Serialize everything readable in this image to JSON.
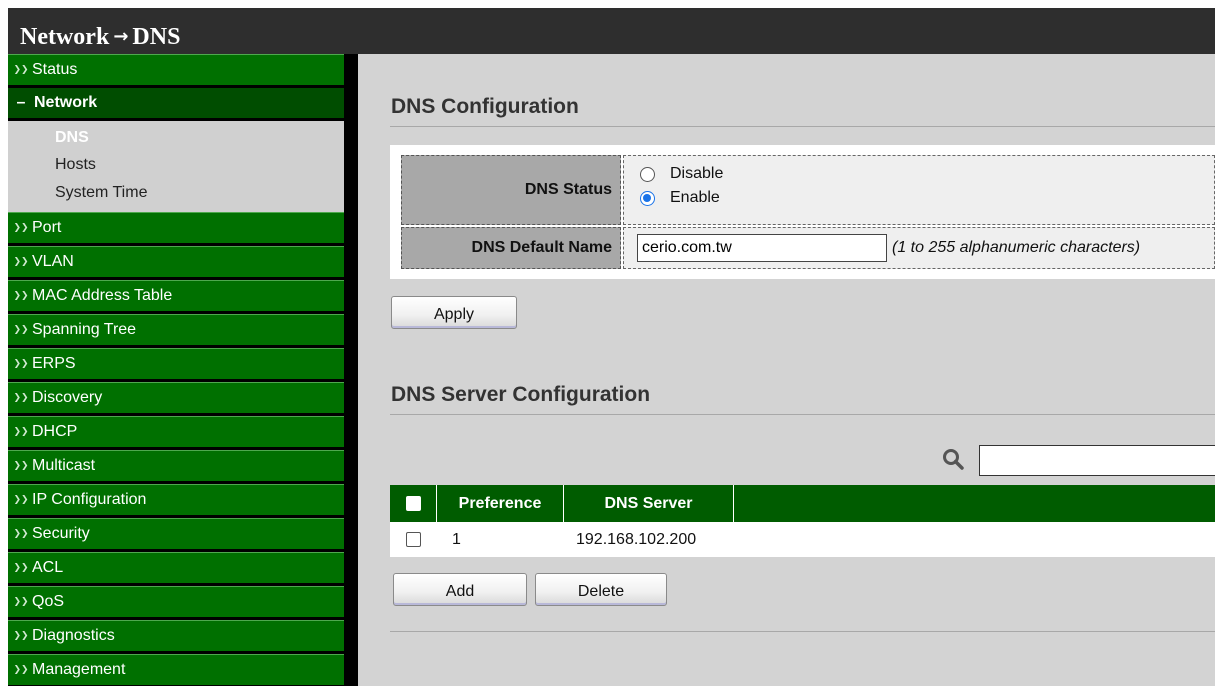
{
  "header": {
    "breadcrumb_parent": "Network",
    "breadcrumb_sep": "→",
    "breadcrumb_current": "DNS"
  },
  "sidebar": {
    "items": [
      {
        "label": "Status",
        "icon": "double-chevron-down-icon"
      },
      {
        "label": "Network",
        "icon": "minus-icon",
        "expanded": true
      },
      {
        "label": "Port",
        "icon": "double-chevron-down-icon"
      },
      {
        "label": "VLAN",
        "icon": "double-chevron-down-icon"
      },
      {
        "label": "MAC Address Table",
        "icon": "double-chevron-down-icon"
      },
      {
        "label": "Spanning Tree",
        "icon": "double-chevron-down-icon"
      },
      {
        "label": "ERPS",
        "icon": "double-chevron-down-icon"
      },
      {
        "label": "Discovery",
        "icon": "double-chevron-down-icon"
      },
      {
        "label": "DHCP",
        "icon": "double-chevron-down-icon"
      },
      {
        "label": "Multicast",
        "icon": "double-chevron-down-icon"
      },
      {
        "label": "IP Configuration",
        "icon": "double-chevron-down-icon"
      },
      {
        "label": "Security",
        "icon": "double-chevron-down-icon"
      },
      {
        "label": "ACL",
        "icon": "double-chevron-down-icon"
      },
      {
        "label": "QoS",
        "icon": "double-chevron-down-icon"
      },
      {
        "label": "Diagnostics",
        "icon": "double-chevron-down-icon"
      },
      {
        "label": "Management",
        "icon": "double-chevron-down-icon"
      }
    ],
    "network_submenu": [
      {
        "label": "DNS",
        "active": true
      },
      {
        "label": "Hosts",
        "active": false
      },
      {
        "label": "System Time",
        "active": false
      }
    ]
  },
  "dns_config": {
    "title": "DNS Configuration",
    "status_label": "DNS Status",
    "status_options": [
      "Disable",
      "Enable"
    ],
    "status_selected": "Enable",
    "default_name_label": "DNS Default Name",
    "default_name_value": "cerio.com.tw",
    "default_name_hint": "(1 to 255 alphanumeric characters)",
    "apply_label": "Apply"
  },
  "dns_server": {
    "title": "DNS Server Configuration",
    "search_value": "",
    "columns": [
      "Preference",
      "DNS Server"
    ],
    "rows": [
      {
        "preference": "1",
        "server": "192.168.102.200",
        "checked": false
      }
    ],
    "add_label": "Add",
    "delete_label": "Delete"
  },
  "colors": {
    "header_bg": "#2e2e2e",
    "menu_green": "#007000",
    "menu_open": "#004d00",
    "table_header": "#005c00",
    "radio_accent": "#1a73e8"
  }
}
